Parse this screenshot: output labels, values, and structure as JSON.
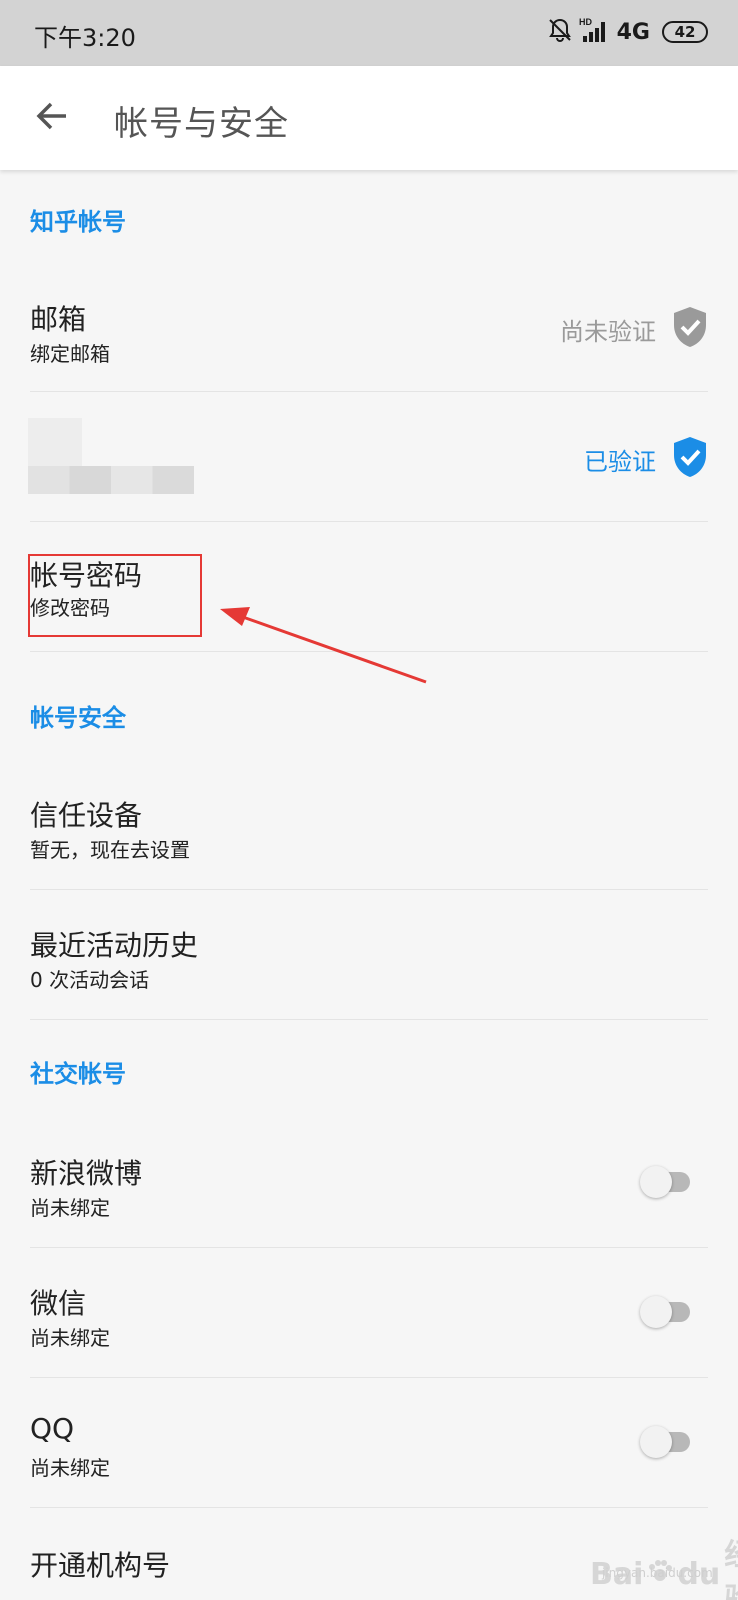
{
  "status_bar": {
    "time": "下午3:20",
    "network": "4G",
    "battery": "42",
    "icons": [
      "bell-off-icon",
      "hd-signal-icon",
      "network-4g-icon",
      "battery-icon"
    ]
  },
  "header": {
    "title": "帐号与安全",
    "back_icon": "arrow-left-icon"
  },
  "sections": {
    "zhihu_account": "知乎帐号",
    "account_security": "帐号安全",
    "social_accounts": "社交帐号"
  },
  "rows": {
    "email": {
      "title": "邮箱",
      "subtitle": "绑定邮箱",
      "status": "尚未验证",
      "status_color": "#9a9a9a"
    },
    "phone": {
      "status": "已验证",
      "status_color": "#1b8de6"
    },
    "password": {
      "title": "帐号密码",
      "subtitle": "修改密码"
    },
    "trusted_devices": {
      "title": "信任设备",
      "subtitle": "暂无，现在去设置"
    },
    "recent_activity": {
      "title": "最近活动历史",
      "subtitle": "0 次活动会话"
    },
    "weibo": {
      "title": "新浪微博",
      "subtitle": "尚未绑定",
      "enabled": false
    },
    "wechat": {
      "title": "微信",
      "subtitle": "尚未绑定",
      "enabled": false
    },
    "qq": {
      "title": "QQ",
      "subtitle": "尚未绑定",
      "enabled": false
    },
    "org_account": {
      "title": "开通机构号"
    }
  },
  "colors": {
    "accent": "#1b8de6",
    "annotation_red": "#e53935",
    "background": "#f6f6f6"
  },
  "watermark": {
    "brand": "Bai",
    "brand_suffix": "du",
    "label": "经验",
    "url": "jingyan.baidu.com"
  }
}
